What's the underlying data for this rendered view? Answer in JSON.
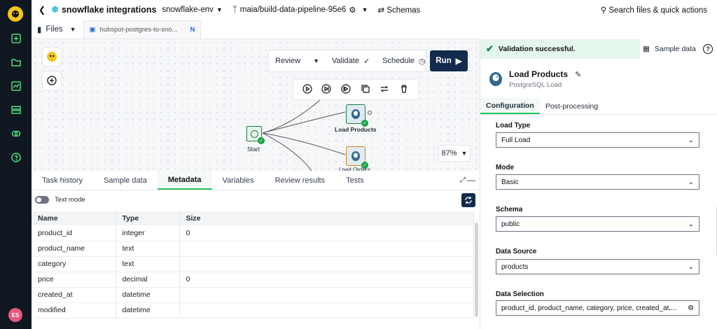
{
  "topbar": {
    "project": "snowflake integrations",
    "env": "snowflake-env",
    "branch": "maia/build-data-pipeline-95e6",
    "schemas": "Schemas",
    "search": "Search files & quick actions"
  },
  "files": {
    "label": "Files",
    "tab_name": "hubspot-postgres-to-sno...",
    "tab_badge": "N"
  },
  "canvas": {
    "review": "Review",
    "validate": "Validate",
    "schedule": "Schedule",
    "run": "Run",
    "zoom": "87%",
    "nodes": {
      "start": "Start",
      "load_products": "Load Products",
      "load_orders": "Load Orders"
    }
  },
  "bottom": {
    "tabs": [
      "Task history",
      "Sample data",
      "Metadata",
      "Variables",
      "Review results",
      "Tests"
    ],
    "active_tab": "Metadata",
    "text_mode": "Text mode",
    "columns": [
      "Name",
      "Type",
      "Size"
    ],
    "rows": [
      [
        "product_id",
        "integer",
        "0"
      ],
      [
        "product_name",
        "text",
        ""
      ],
      [
        "category",
        "text",
        ""
      ],
      [
        "price",
        "decimal",
        "0"
      ],
      [
        "created_at",
        "datetime",
        ""
      ],
      [
        "modified",
        "datetime",
        ""
      ]
    ]
  },
  "right": {
    "validation": "Validation successful.",
    "sample_data": "Sample data",
    "help": "?",
    "component_name": "Load Products",
    "component_type": "PostgreSQL Load",
    "tabs": [
      "Configuration",
      "Post-processing"
    ],
    "fields": {
      "load_type": {
        "label": "Load Type",
        "value": "Full Load"
      },
      "mode": {
        "label": "Mode",
        "value": "Basic"
      },
      "schema": {
        "label": "Schema",
        "value": "public"
      },
      "data_source": {
        "label": "Data Source",
        "value": "products"
      },
      "data_selection": {
        "label": "Data Selection",
        "value": "product_id, product_name, category, price, created_at,..."
      }
    }
  },
  "user": {
    "initials": "ES"
  },
  "colors": {
    "accent_green": "#22c55e",
    "navy": "#132a4c",
    "rail": "#0f1720"
  }
}
